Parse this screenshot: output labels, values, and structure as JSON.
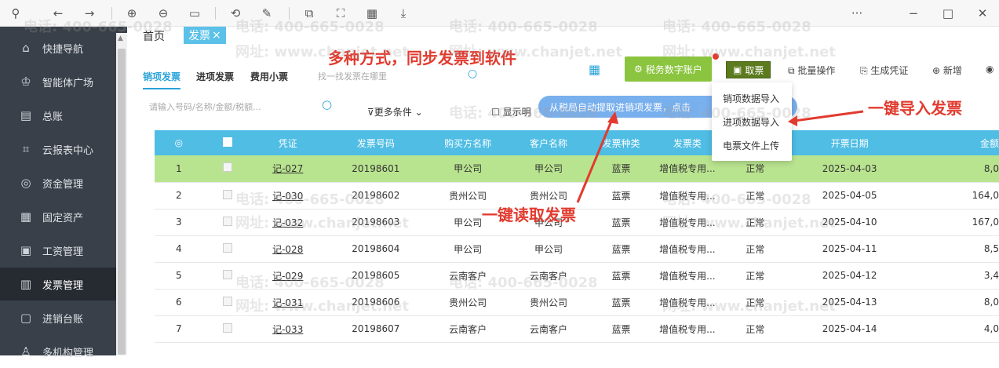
{
  "toolbar": {
    "icons": [
      "pin-icon",
      "back-icon",
      "forward-icon",
      "zoom-in-icon",
      "zoom-out-icon",
      "fit-icon",
      "rotate-icon",
      "edit-icon",
      "crop-icon",
      "scan-icon",
      "qr-icon",
      "save-icon"
    ],
    "more": "···",
    "minimize": "−",
    "maximize": "□",
    "close": "✕"
  },
  "sidebar": {
    "items": [
      {
        "label": "快捷导航",
        "icon": "home-icon",
        "glyph": "⌂"
      },
      {
        "label": "智能体广场",
        "icon": "umbrella-icon",
        "glyph": "♔"
      },
      {
        "label": "总账",
        "icon": "ledger-icon",
        "glyph": "▤"
      },
      {
        "label": "云报表中心",
        "icon": "chart-icon",
        "glyph": "📈"
      },
      {
        "label": "资金管理",
        "icon": "money-icon",
        "glyph": "◎"
      },
      {
        "label": "固定资产",
        "icon": "asset-icon",
        "glyph": "▦"
      },
      {
        "label": "工资管理",
        "icon": "salary-icon",
        "glyph": "▣"
      },
      {
        "label": "发票管理",
        "icon": "invoice-icon",
        "glyph": "▥",
        "active": true
      },
      {
        "label": "进销台账",
        "icon": "account-icon",
        "glyph": "▢"
      },
      {
        "label": "多机构管理",
        "icon": "org-icon",
        "glyph": "♙"
      }
    ]
  },
  "tabs": {
    "home": "首页",
    "active": "发票",
    "close": "×"
  },
  "subtabs": [
    "销项发票",
    "进项发票",
    "费用小票"
  ],
  "search": {
    "placeholder": "找一找发票在哪里"
  },
  "filter": {
    "placeholder": "请输入号码/名称/金额/税额...",
    "more": "更多条件",
    "show_detail": "显示明"
  },
  "buttons": {
    "tax_account": "税务数字账户",
    "fetch": "取票",
    "batch": "批量操作",
    "voucher": "生成凭证",
    "add": "新增"
  },
  "tooltip": "从税局自动提取进销项发票，点击",
  "dropdown": [
    "销项数据导入",
    "进项数据导入",
    "电票文件上传"
  ],
  "annotations": {
    "top": "多种方式，同步发票到软件",
    "right": "一键导入发票",
    "mid": "一键读取发票"
  },
  "table": {
    "headers": [
      "凭证",
      "发票号码",
      "购买方名称",
      "客户名称",
      "发票种类",
      "发票类",
      "",
      "开票日期",
      "金额"
    ],
    "rows": [
      {
        "no": "1",
        "voucher": "记-027",
        "invoice": "20198601",
        "buyer": "甲公司",
        "customer": "甲公司",
        "kind": "蓝票",
        "type": "增值税专用...",
        "status": "正常",
        "date": "2025-04-03",
        "amount": "8,0"
      },
      {
        "no": "2",
        "voucher": "记-030",
        "invoice": "20198602",
        "buyer": "贵州公司",
        "customer": "贵州公司",
        "kind": "蓝票",
        "type": "增值税专用...",
        "status": "正常",
        "date": "2025-04-05",
        "amount": "164,0"
      },
      {
        "no": "3",
        "voucher": "记-032",
        "invoice": "20198603",
        "buyer": "甲公司",
        "customer": "甲公司",
        "kind": "蓝票",
        "type": "增值税专用...",
        "status": "正常",
        "date": "2025-04-10",
        "amount": "167,0"
      },
      {
        "no": "4",
        "voucher": "记-028",
        "invoice": "20198604",
        "buyer": "甲公司",
        "customer": "甲公司",
        "kind": "蓝票",
        "type": "增值税专用...",
        "status": "正常",
        "date": "2025-04-11",
        "amount": "8,5"
      },
      {
        "no": "5",
        "voucher": "记-029",
        "invoice": "20198605",
        "buyer": "云南客户",
        "customer": "云南客户",
        "kind": "蓝票",
        "type": "增值税专用...",
        "status": "正常",
        "date": "2025-04-12",
        "amount": "3,4"
      },
      {
        "no": "6",
        "voucher": "记-031",
        "invoice": "20198606",
        "buyer": "贵州公司",
        "customer": "贵州公司",
        "kind": "蓝票",
        "type": "增值税专用...",
        "status": "正常",
        "date": "2025-04-13",
        "amount": "8,0"
      },
      {
        "no": "7",
        "voucher": "记-033",
        "invoice": "20198607",
        "buyer": "云南客户",
        "customer": "云南客户",
        "kind": "蓝票",
        "type": "增值税专用...",
        "status": "正常",
        "date": "2025-04-14",
        "amount": "4,0"
      }
    ]
  },
  "watermark": {
    "phone": "电话: 400-665-0028",
    "site": "网址: www.chanjet.net"
  },
  "colors": {
    "accent": "#4fbde4",
    "green": "#8bc43f",
    "annotation": "#e23a2e",
    "selected_row": "#b9e48f"
  }
}
